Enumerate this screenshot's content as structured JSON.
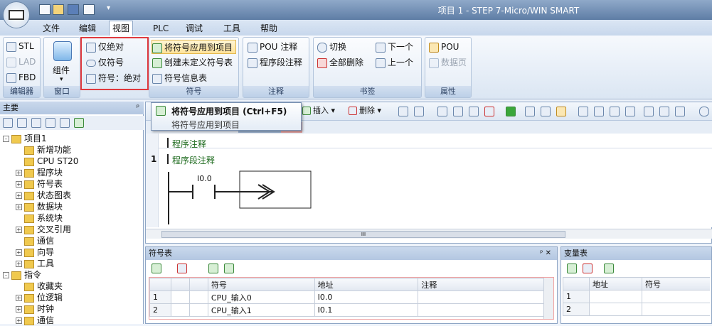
{
  "window": {
    "title": "项目 1 - STEP 7-Micro/WIN SMART"
  },
  "menus": [
    "文件",
    "编辑",
    "视图",
    "PLC",
    "调试",
    "工具",
    "帮助"
  ],
  "ribbon": {
    "editor": {
      "title": "编辑器",
      "items": [
        "STL",
        "LAD",
        "FBD"
      ]
    },
    "window": {
      "title": "窗口",
      "item": "组件"
    },
    "symbol_view": {
      "items": [
        "仅绝对",
        "仅符号",
        "符号：绝对"
      ]
    },
    "symbols": {
      "title": "符号",
      "items": [
        "将符号应用到项目",
        "创建未定义符号表",
        "符号信息表"
      ]
    },
    "comments": {
      "title": "注释",
      "items": [
        "POU 注释",
        "程序段注释"
      ]
    },
    "bookmarks": {
      "title": "书签",
      "items": [
        "切换",
        "全部删除",
        "下一个",
        "上一个"
      ]
    },
    "properties": {
      "title": "属性",
      "items": [
        "POU",
        "数据页"
      ]
    }
  },
  "tooltip": {
    "title": "将符号应用到项目 (Ctrl+F5)",
    "desc": "将符号应用到项目"
  },
  "left_panel": {
    "title": "主要",
    "tree": [
      {
        "label": "项目1",
        "level": 0,
        "exp": "-"
      },
      {
        "label": "新增功能",
        "level": 1,
        "exp": ""
      },
      {
        "label": "CPU ST20",
        "level": 1,
        "exp": ""
      },
      {
        "label": "程序块",
        "level": 1,
        "exp": "+"
      },
      {
        "label": "符号表",
        "level": 1,
        "exp": "+"
      },
      {
        "label": "状态图表",
        "level": 1,
        "exp": "+"
      },
      {
        "label": "数据块",
        "level": 1,
        "exp": "+"
      },
      {
        "label": "系统块",
        "level": 1,
        "exp": ""
      },
      {
        "label": "交叉引用",
        "level": 1,
        "exp": "+"
      },
      {
        "label": "通信",
        "level": 1,
        "exp": ""
      },
      {
        "label": "向导",
        "level": 1,
        "exp": "+"
      },
      {
        "label": "工具",
        "level": 1,
        "exp": "+"
      },
      {
        "label": "指令",
        "level": 0,
        "exp": "-"
      },
      {
        "label": "收藏夹",
        "level": 1,
        "exp": ""
      },
      {
        "label": "位逻辑",
        "level": 1,
        "exp": "+"
      },
      {
        "label": "时钟",
        "level": 1,
        "exp": "+"
      },
      {
        "label": "通信",
        "level": 1,
        "exp": "+"
      }
    ]
  },
  "editor": {
    "tool_insert": "插入",
    "tool_delete": "删除",
    "program_comment": "程序注释",
    "rung_number": "1",
    "rung_comment": "程序段注释",
    "contact_addr": "I0.0",
    "scroll_mark": "III"
  },
  "symbol_table": {
    "title": "符号表",
    "headers": [
      "",
      "",
      "",
      "符号",
      "地址",
      "注释"
    ],
    "rows": [
      [
        "1",
        "",
        "",
        "CPU_输入0",
        "I0.0",
        ""
      ],
      [
        "2",
        "",
        "",
        "CPU_输入1",
        "I0.1",
        ""
      ]
    ]
  },
  "var_table": {
    "title": "变量表",
    "headers": [
      "",
      "地址",
      "符号"
    ],
    "rows": [
      [
        "1",
        "",
        ""
      ],
      [
        "2",
        "",
        ""
      ]
    ]
  }
}
